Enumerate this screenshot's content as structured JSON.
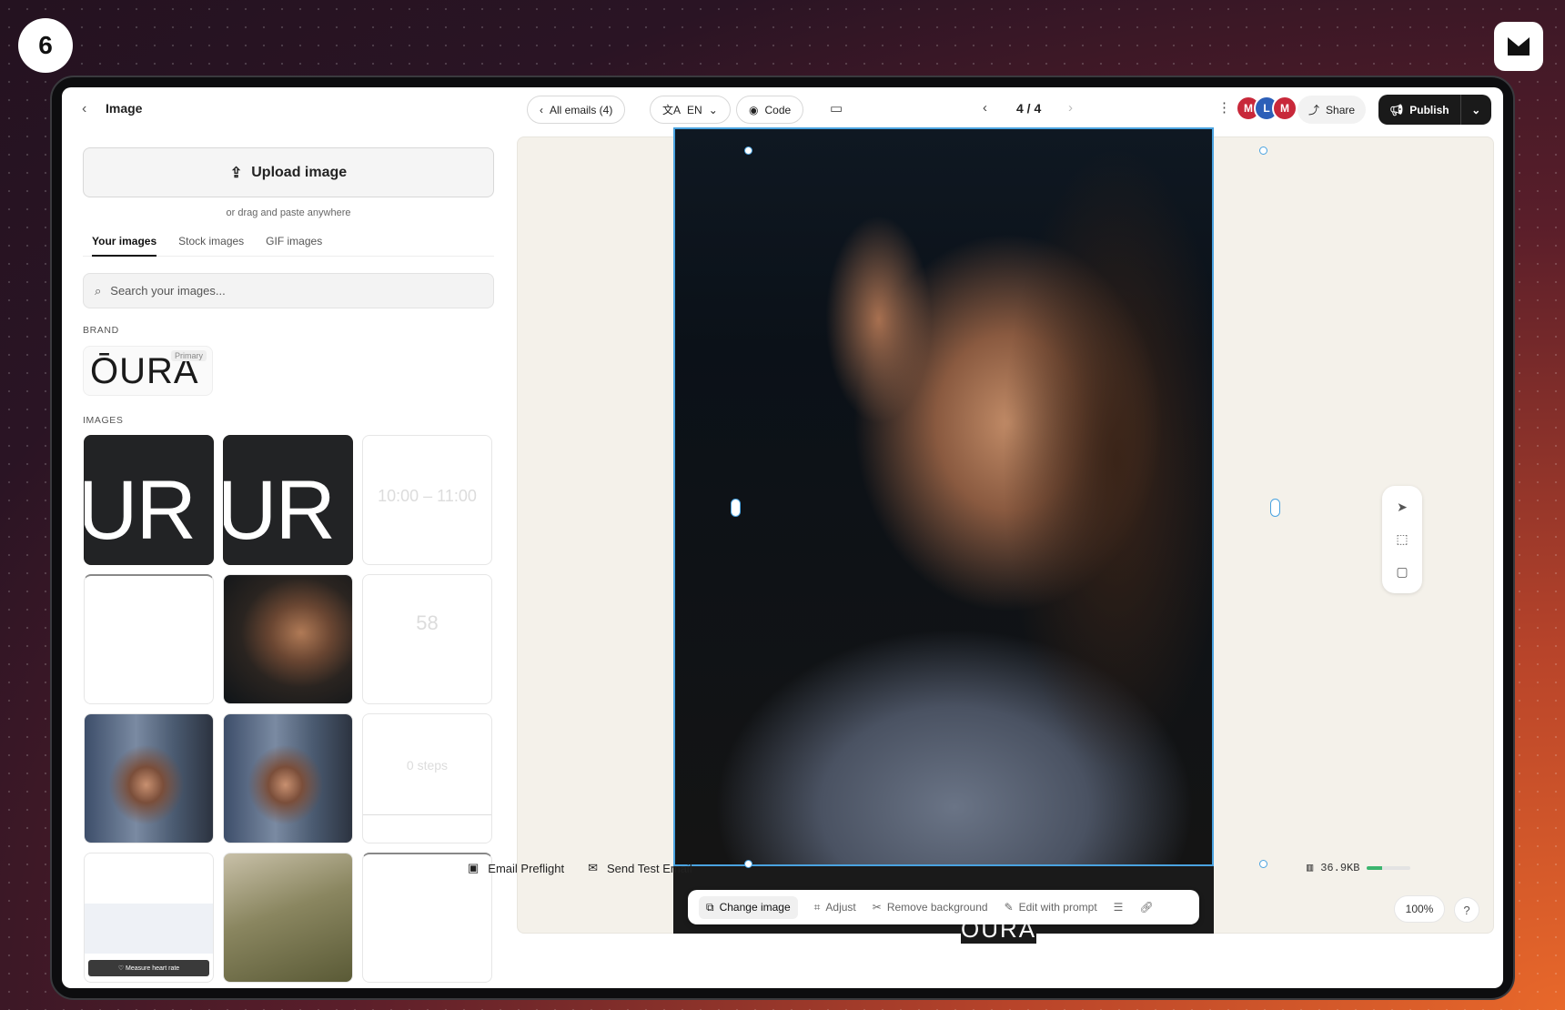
{
  "step_number": "6",
  "header": {
    "title": "Image",
    "all_emails_label": "All emails (4)",
    "language_label": "EN",
    "code_label": "Code",
    "pager": "4 / 4",
    "share_label": "Share",
    "publish_label": "Publish",
    "avatar_letter": "L"
  },
  "left_panel": {
    "upload_label": "Upload image",
    "drag_hint": "or drag and paste anywhere",
    "tabs": [
      "Your images",
      "Stock images",
      "GIF images"
    ],
    "search_placeholder": "Search your images...",
    "brand_section": "BRAND",
    "brand_word": "ŌURA",
    "brand_tag": "Primary",
    "images_section": "IMAGES",
    "thumb_word": "UR",
    "thumb_button": "♡ Measure heart rate"
  },
  "image_toolbar": {
    "change_image": "Change image",
    "adjust": "Adjust",
    "remove_background": "Remove background",
    "edit_with_prompt": "Edit with prompt"
  },
  "canvas": {
    "email_footer_word": "OURA",
    "zoom": "100%"
  },
  "bottom_bar": {
    "preflight": "Email Preflight",
    "send_test": "Send Test Email",
    "size": "36.9KB",
    "size_fraction": 0.35
  },
  "colors": {
    "accent": "#4aa3e0",
    "publish_bg": "#1a1a1a",
    "size_fill": "#3bb56e",
    "avatar_blue": "#2c5fb8"
  }
}
